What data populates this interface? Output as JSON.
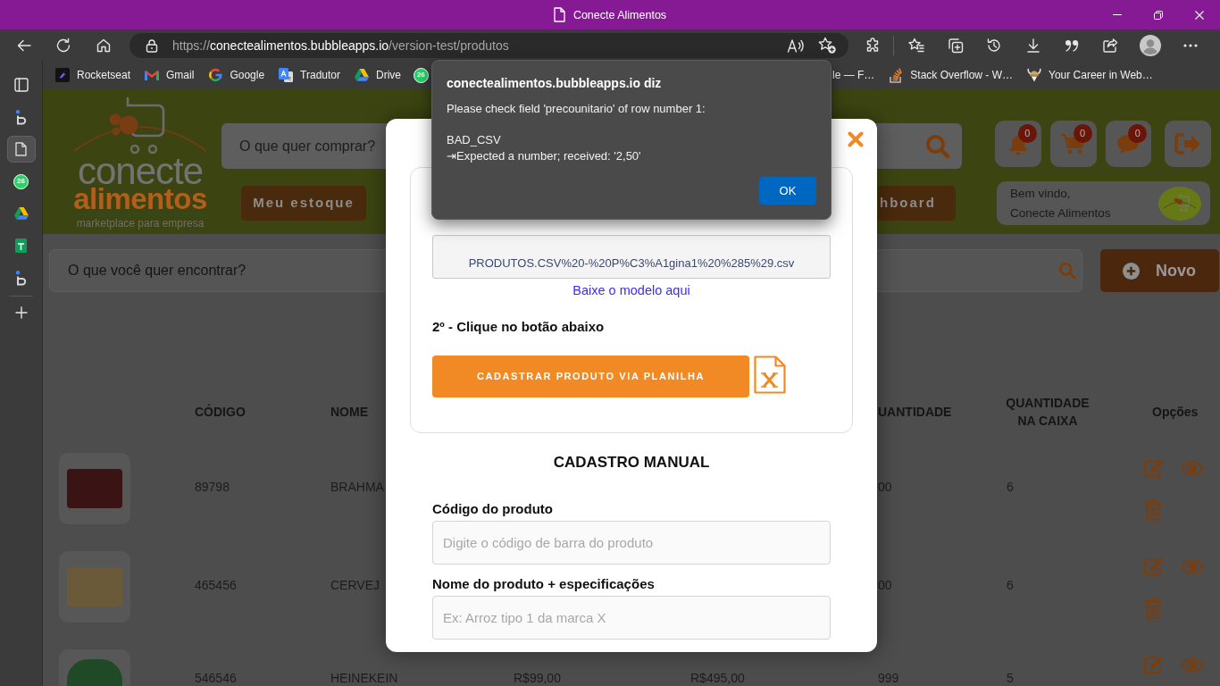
{
  "window": {
    "title": "Conecte Alimentos"
  },
  "address_bar": {
    "scheme": "https://",
    "host": "conectealimentos.bubbleapps.io",
    "path": "/version-test/produtos"
  },
  "bookmarks": [
    {
      "label": "Rocketseat"
    },
    {
      "label": "Gmail"
    },
    {
      "label": "Google"
    },
    {
      "label": "Tradutor"
    },
    {
      "label": "Drive"
    },
    {
      "badge": "26"
    },
    {
      "label": "le — F…"
    },
    {
      "label": "Stack Overflow - W…"
    },
    {
      "label": "Your Career in Web…"
    }
  ],
  "vertical_tabs": [
    {
      "selected": false
    },
    {
      "selected": true
    },
    {
      "selected": false,
      "badge": "26"
    },
    {
      "selected": false
    },
    {
      "selected": false
    },
    {
      "selected": false
    }
  ],
  "header": {
    "logo": {
      "wordmark": [
        "conecte",
        "alimentos"
      ],
      "tagline": "marketplace para empresa"
    },
    "search": {
      "placeholder": "O que quer comprar?"
    },
    "buttons": [
      {
        "label": "Meu estoque"
      },
      {
        "label": "hboard"
      }
    ],
    "tiles": [
      {
        "badge": "0"
      },
      {
        "badge": "0"
      },
      {
        "badge": "0"
      }
    ],
    "welcome": {
      "greeting": "Bem vindo,",
      "name": "Conecte Alimentos"
    }
  },
  "toolbar": {
    "search": {
      "placeholder": "O que você quer encontrar?"
    },
    "new_button": "Novo"
  },
  "table": {
    "columns": [
      {
        "label": "CÓDIGO"
      },
      {
        "label": "NOME"
      },
      {
        "label": "UANTIDADE"
      },
      {
        "label": "QUANTIDADE NA CAIXA"
      },
      {
        "label": "Opções"
      }
    ],
    "rows": [
      {
        "code": "89798",
        "name": "BRAHMA",
        "quantity": "00",
        "box_quantity": "6",
        "actions": [
          {
            "kind": "edit"
          },
          {
            "kind": "view"
          },
          {
            "kind": "delete"
          }
        ]
      },
      {
        "code": "465456",
        "name": "CERVEJ",
        "quantity": "00",
        "box_quantity": "6",
        "actions": [
          {
            "kind": "edit"
          },
          {
            "kind": "view"
          },
          {
            "kind": "delete"
          }
        ]
      },
      {
        "code": "546546",
        "name": "HEINEKEIN",
        "column_3": "R$99,00",
        "column_4": "R$495,00",
        "quantity": "999",
        "box_quantity": "5",
        "actions": [
          {
            "kind": "edit"
          },
          {
            "kind": "view"
          }
        ]
      }
    ]
  },
  "modal": {
    "file_name": "PRODUTOS.CSV%20-%20P%C3%A1gina1%20%285%29.csv",
    "template_link": "Baixe o modelo aqui",
    "step_2": "2º - Clique no botão abaixo",
    "upload_button": "CADASTRAR PRODUTO VIA PLANILHA",
    "manual_title": "CADASTRO MANUAL",
    "fields": [
      {
        "label": "Código do produto",
        "placeholder": "Digite o código de barra do produto"
      },
      {
        "label": "Nome do produto + especificações",
        "placeholder": "Ex: Arroz tipo 1 da marca X"
      }
    ]
  },
  "alert": {
    "title": "conectealimentos.bubbleapps.io diz",
    "message": "Please check field 'precounitario' of row number 1:",
    "details": [
      "BAD_CSV",
      "⇥Expected a number; received: '2,50'"
    ],
    "button": "OK"
  }
}
